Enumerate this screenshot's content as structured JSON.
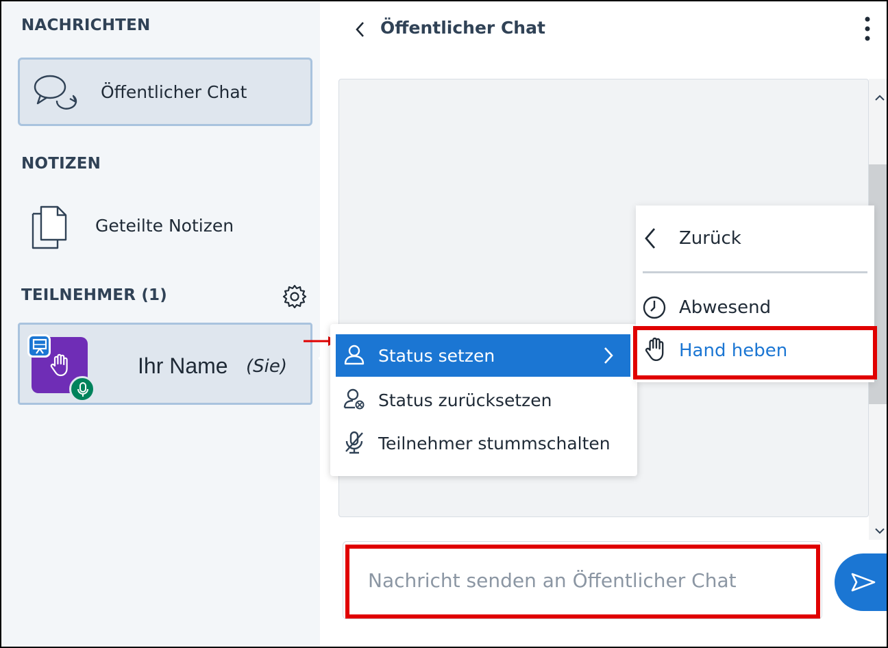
{
  "sidebar": {
    "messages_title": "NACHRICHTEN",
    "public_chat_label": "Öffentlicher Chat",
    "notes_title": "NOTIZEN",
    "shared_notes_label": "Geteilte Notizen",
    "participants_title": "TEILNEHMER (1)",
    "user": {
      "name": "Ihr Name",
      "you_tag": "(Sie)",
      "status": "raised-hand-icon",
      "role": "presenter",
      "mic": "on"
    }
  },
  "chat": {
    "title": "Öffentlicher Chat",
    "input_placeholder": "Nachricht senden an Öffentlicher Chat"
  },
  "context_menu": {
    "items": [
      {
        "label": "Status setzen",
        "icon": "user-icon",
        "active": true
      },
      {
        "label": "Status zurücksetzen",
        "icon": "user-clear-icon"
      },
      {
        "label": "Teilnehmer stummschalten",
        "icon": "mic-muted-icon"
      }
    ]
  },
  "status_submenu": {
    "back_label": "Zurück",
    "items": [
      {
        "label": "Abwesend",
        "icon": "clock-icon"
      },
      {
        "label": "Hand heben",
        "icon": "raised-hand-icon",
        "highlighted": true
      }
    ]
  },
  "colors": {
    "accent": "#1b76d3",
    "avatar": "#6f2db6",
    "mic_on": "#00835c",
    "annotation_red": "#e00000",
    "sidebar_bg": "#f3f6f9"
  }
}
